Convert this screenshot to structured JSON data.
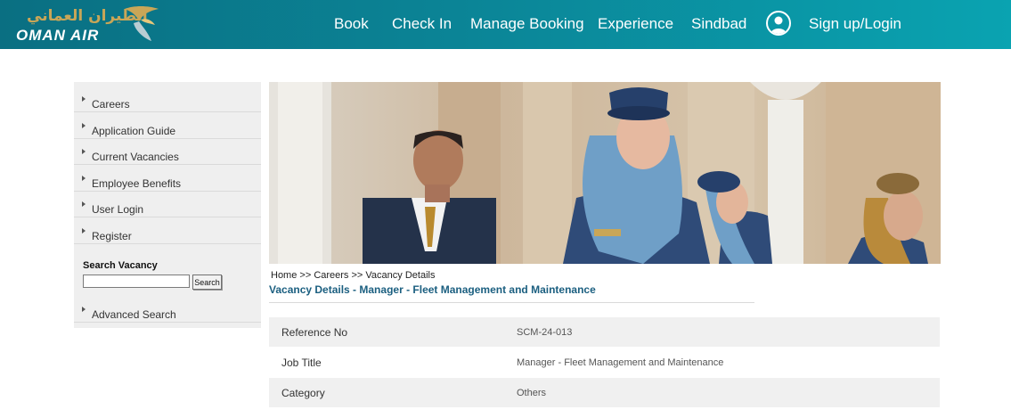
{
  "header": {
    "logo_arabic": "الطيران العماني",
    "logo_text": "OMAN AIR",
    "nav": [
      {
        "label": "Book"
      },
      {
        "label": "Check In"
      },
      {
        "label": "Manage Booking"
      },
      {
        "label": "Experience"
      },
      {
        "label": "Sindbad"
      }
    ],
    "login_label": "Sign up/Login"
  },
  "sidebar": {
    "items": [
      {
        "label": "Careers"
      },
      {
        "label": "Application Guide"
      },
      {
        "label": "Current Vacancies"
      },
      {
        "label": "Employee Benefits"
      },
      {
        "label": "User Login"
      },
      {
        "label": "Register"
      }
    ],
    "search_title": "Search Vacancy",
    "search_value": "",
    "search_button": "Search",
    "advanced_search": "Advanced Search"
  },
  "breadcrumb": {
    "items": [
      "Home",
      "Careers",
      "Vacancy Details"
    ],
    "separator": ">>"
  },
  "page_title": "Vacancy Details - Manager - Fleet Management and Maintenance",
  "details": [
    {
      "label": "Reference No",
      "value": "SCM-24-013"
    },
    {
      "label": "Job Title",
      "value": "Manager - Fleet Management and Maintenance"
    },
    {
      "label": "Category",
      "value": "Others"
    }
  ],
  "colors": {
    "header_start": "#0a6f82",
    "header_end": "#0aa3b1",
    "logo_gold": "#c9a657",
    "title_blue": "#1b5f80",
    "sidebar_bg": "#efefef"
  },
  "icons": [
    "oman-air-bird-logo",
    "user-icon",
    "chevron-right-icon"
  ]
}
